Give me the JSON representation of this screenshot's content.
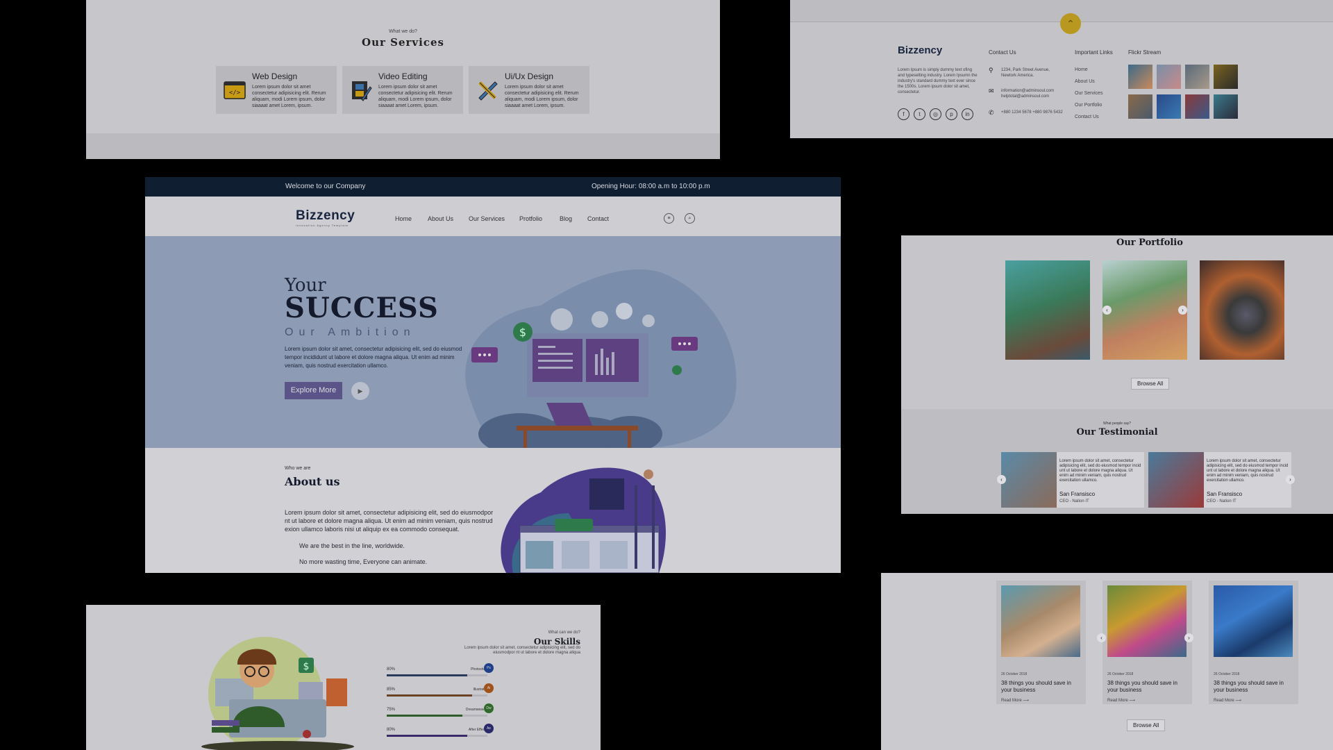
{
  "services": {
    "eyebrow": "What we do?",
    "title": "Our Services",
    "items": [
      {
        "name": "Web Design",
        "desc": "Lorem ipsum dolor sit amet consectetur adipisicing elit. Rerum aliquam, modi Lorem ipsum, dolor siaaaat amet Lorem, ipsum."
      },
      {
        "name": "Video Editing",
        "desc": "Lorem ipsum dolor sit amet consectetur adipisicing elit. Rerum aliquam, modi Lorem ipsum, dolor siaaaat amet Lorem, ipsum."
      },
      {
        "name": "Ui/Ux Design",
        "desc": "Lorem ipsum dolor sit amet consectetur adipisicing elit. Rerum aliquam, modi Lorem ipsum, dolor siaaaat amet Lorem, ipsum."
      }
    ]
  },
  "footer": {
    "scroll_top": "⌃",
    "logo": "Bizzency",
    "about": "Lorem Ipsum is simply dummy text ofing and typesetting industry. Lorem Ipsumn the industry's standard dummy text ever since the 1500s. Lorem ipsum dolor sit amet, consectetur.",
    "social": [
      "f",
      "t",
      "◎",
      "p",
      "in"
    ],
    "contact_heading": "Contact Us",
    "address": "1234, Park Street Avenue, Newtork America.",
    "emails": "information@adminsoul.com helptotal@adminsoul.com",
    "phones": "+880 1234 5678 +880 9876 5432",
    "links_heading": "Important Links",
    "links": [
      "Home",
      "About Us",
      "Our Services",
      "Our Portfolio",
      "Contact Us"
    ],
    "flickr_heading": "Flickr Stream"
  },
  "main": {
    "topbar": {
      "welcome": "Welcome to our Company",
      "hours": "Opening Hour: 08:00 a.m to 10:00 p.m"
    },
    "logo": "Bizzency",
    "logo_tag": "Innovation Agency Template",
    "nav": [
      "Home",
      "About Us",
      "Our Services",
      "Protfolio",
      "Blog",
      "Contact"
    ],
    "hero": {
      "your": "Your",
      "success": "SUCCESS",
      "ambition": "Our Ambition",
      "text": "Lorem ipsum dolor sit amet, consectetur adipisicing elit, sed do eiusmod tempor incididunt ut labore et dolore magna aliqua. Ut enim ad minim veniam, quis nostrud exercitation ullamco.",
      "button": "Explore More",
      "play": "▶"
    },
    "about": {
      "eyebrow": "Who we are",
      "title": "About us",
      "text": "Lorem ipsum dolor sit amet, consectetur adipisicing elit, sed do eiusmodpor nt ut labore et dolore magna aliqua. Ut enim ad minim veniam, quis nostrud exion ullamco laboris nisi ut aliquip ex ea commodo consequat.",
      "points": [
        "We are the best in the line, worldwide.",
        "No more wasting time, Everyone can animate."
      ]
    }
  },
  "portfolio": {
    "title": "Our Portfolio",
    "browse": "Browse All",
    "prev": "‹",
    "next": "›",
    "testimonial_eyebrow": "What people say?",
    "testimonial_title": "Our Testimonial",
    "testimonials": [
      {
        "text": "Lorem ipsum dolor sit amet, consectetur adipisicing elit, sed do eiusmod tempor incid unt ut labore et dolore magna aliqua. Ut enim ad minim veniam, quis nostrud exercitation ullamco.",
        "name": "San Fransisco",
        "role": "CEO - Nation IT"
      },
      {
        "text": "Lorem ipsum dolor sit amet, consectetur adipisicing elit, sed do eiusmod tempor incid unt ut labore et dolore magna aliqua. Ut enim ad minim veniam, quis nostrud exercitation ullamco.",
        "name": "San Fransisco",
        "role": "CEO - Nation IT"
      }
    ]
  },
  "skills": {
    "eyebrow": "What can we do?",
    "title": "Our Skills",
    "text": "Lorem ipsum dolor sit amet, consectetur adipisicing elit, sed do eiusmodpor nt ut labore et dolore magna aliqua",
    "items": [
      {
        "pct": "80%",
        "value": 0.8,
        "name": "Photoshop",
        "badge": "Ps",
        "color": "#1f3f8a",
        "bar": "#2a3a5a"
      },
      {
        "pct": "85%",
        "value": 0.85,
        "name": "Illustrator",
        "badge": "Ai",
        "color": "#a0521a",
        "bar": "#6a4326"
      },
      {
        "pct": "75%",
        "value": 0.75,
        "name": "Dreamweaver",
        "badge": "Dw",
        "color": "#2f6a2a",
        "bar": "#2f5a2a"
      },
      {
        "pct": "80%",
        "value": 0.8,
        "name": "After Effects",
        "badge": "Ae",
        "color": "#2a2a6a",
        "bar": "#3a2a6a"
      }
    ]
  },
  "blog": {
    "posts": [
      {
        "date": "26 October 2018",
        "title": "38 things you should save in your business",
        "more": "Read More  ⟶"
      },
      {
        "date": "26 October 2018",
        "title": "38 things you should save in your business",
        "more": "Read More  ⟶"
      },
      {
        "date": "26 October 2018",
        "title": "38 things you should save in your business",
        "more": "Read More  ⟶"
      }
    ],
    "browse": "Browse All",
    "prev": "‹",
    "next": "›"
  }
}
